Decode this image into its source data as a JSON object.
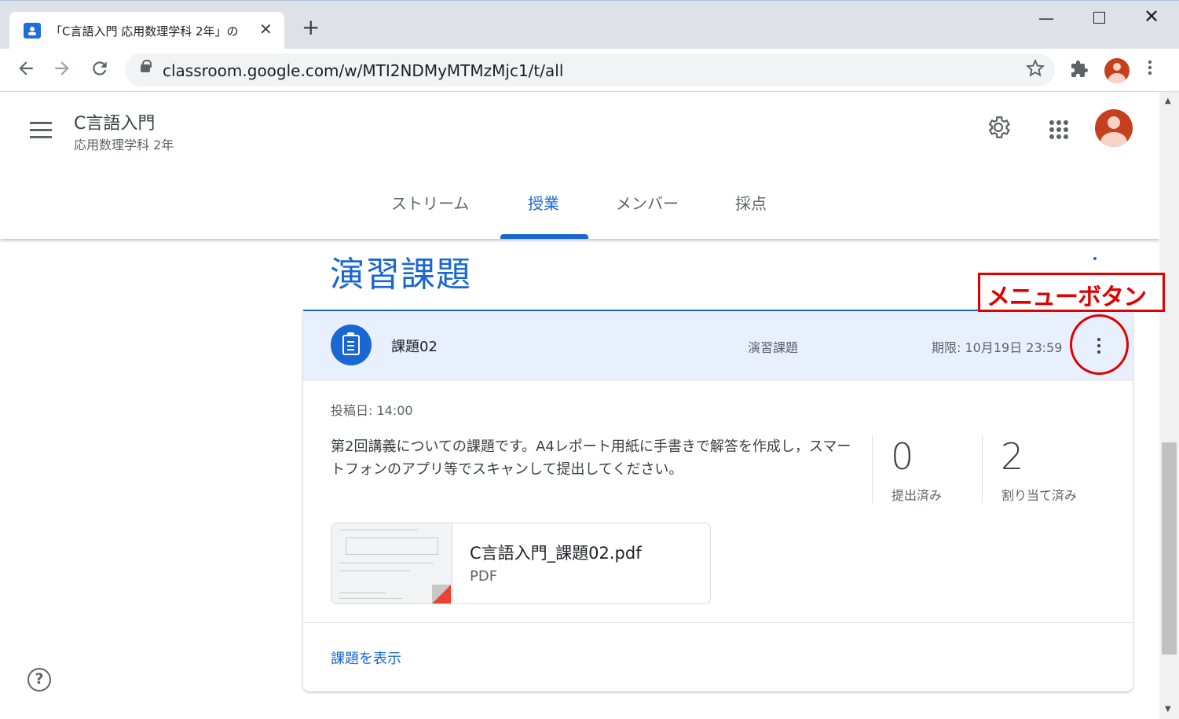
{
  "browser": {
    "tab_title": "「C言語入門 応用数理学科 2年」の",
    "tab_close": "✕",
    "new_tab": "+",
    "url": "classroom.google.com/w/MTI2NDMyMTMzMjc1/t/all",
    "win_min": "—",
    "win_close": "✕"
  },
  "course": {
    "title": "C言語入門",
    "subtitle": "応用数理学科 2年"
  },
  "tabs": [
    {
      "label": "ストリーム"
    },
    {
      "label": "授業"
    },
    {
      "label": "メンバー"
    },
    {
      "label": "採点"
    }
  ],
  "active_tab": "授業",
  "topic": {
    "title": "演習課題"
  },
  "assignment": {
    "name": "課題02",
    "topic": "演習課題",
    "due": "期限: 10月19日 23:59",
    "posted": "投稿日: 14:00",
    "description": "第2回講義についての課題です。A4レポート用紙に手書きで解答を作成し，スマートフォンのアプリ等でスキャンして提出してください。",
    "stats": [
      {
        "value": "0",
        "label": "提出済み"
      },
      {
        "value": "2",
        "label": "割り当て済み"
      }
    ],
    "attachment": {
      "name": "C言語入門_課題02.pdf",
      "type": "PDF"
    },
    "view_link": "課題を表示"
  },
  "annotation": {
    "label": "メニューボタン",
    "color": "#e00000"
  },
  "help": "?",
  "colors": {
    "accent": "#1967d2",
    "card_header": "#e8f0fe",
    "avatar": "#c5401e"
  }
}
